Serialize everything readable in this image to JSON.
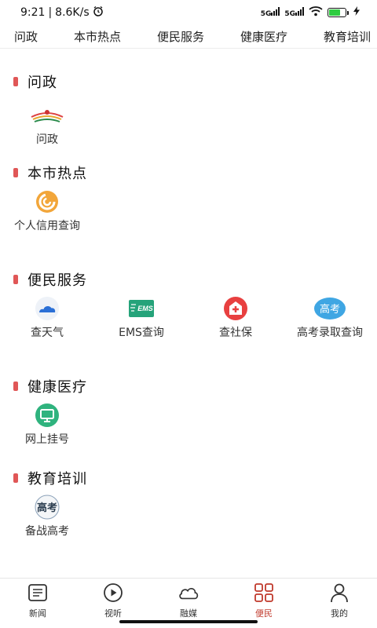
{
  "status": {
    "time": "9:21",
    "speed": "8.6K/s",
    "signal1": "5G",
    "signal2": "5G"
  },
  "top_tabs": [
    "问政",
    "本市热点",
    "便民服务",
    "健康医疗",
    "教育培训"
  ],
  "sections": {
    "wenzheng": {
      "title": "问政",
      "items": [
        {
          "label": "问政",
          "icon": "wenzheng-logo-icon"
        }
      ]
    },
    "hotspot": {
      "title": "本市热点",
      "items": [
        {
          "label": "个人信用查询",
          "icon": "credit-icon"
        }
      ]
    },
    "service": {
      "title": "便民服务",
      "items": [
        {
          "label": "查天气",
          "icon": "weather-cloud-icon"
        },
        {
          "label": "EMS查询",
          "icon": "ems-icon",
          "icon_text": "EMS"
        },
        {
          "label": "查社保",
          "icon": "social-security-icon"
        },
        {
          "label": "高考录取查询",
          "icon": "gaokao-icon",
          "icon_text": "高考"
        }
      ]
    },
    "health": {
      "title": "健康医疗",
      "items": [
        {
          "label": "网上挂号",
          "icon": "monitor-icon"
        }
      ]
    },
    "education": {
      "title": "教育培训",
      "items": [
        {
          "label": "备战高考",
          "icon": "exam-prep-icon",
          "icon_text": "高考"
        }
      ]
    }
  },
  "bottom_nav": [
    {
      "label": "新闻",
      "icon": "news-list-icon"
    },
    {
      "label": "视听",
      "icon": "play-icon"
    },
    {
      "label": "融媒",
      "icon": "cloud-icon"
    },
    {
      "label": "便民",
      "icon": "grid-icon",
      "active": true
    },
    {
      "label": "我的",
      "icon": "person-icon"
    }
  ],
  "colors": {
    "accent": "#e05757",
    "nav_active": "#c0392b",
    "ems_green": "#25a37a",
    "weather_blue": "#2a6fd6",
    "social_red": "#e84040",
    "gaokao_blue": "#3fa6e3",
    "health_green": "#2fb37e"
  }
}
